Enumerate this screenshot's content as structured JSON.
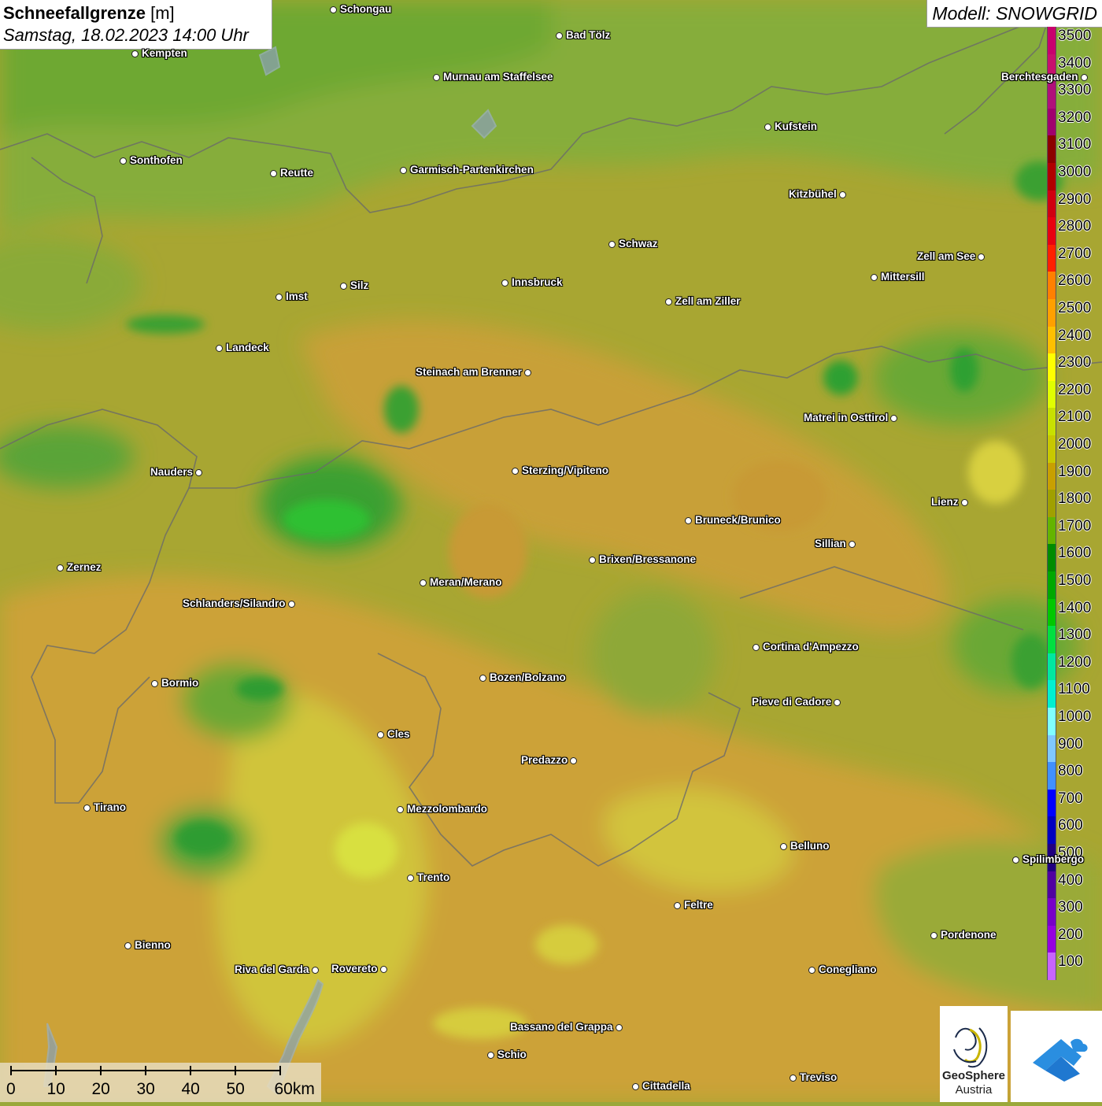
{
  "title": {
    "main": "Schneefallgrenze",
    "unit": "[m]",
    "datetime": "Samstag, 18.02.2023 14:00 Uhr"
  },
  "model": "Modell: SNOWGRID",
  "legend": {
    "levels": [
      "3500",
      "3400",
      "3300",
      "3200",
      "3100",
      "3000",
      "2900",
      "2800",
      "2700",
      "2600",
      "2500",
      "2400",
      "2300",
      "2200",
      "2100",
      "2000",
      "1900",
      "1800",
      "1700",
      "1600",
      "1500",
      "1400",
      "1300",
      "1200",
      "1100",
      "1000",
      "900",
      "800",
      "700",
      "600",
      "500",
      "400",
      "300",
      "200",
      "100"
    ],
    "colors": [
      "#c8006e",
      "#c8106e",
      "#b0107a",
      "#a0006e",
      "#8c0000",
      "#b00000",
      "#d00010",
      "#e80010",
      "#ff2000",
      "#ff8000",
      "#ffa000",
      "#ffc000",
      "#ffff00",
      "#e0ff00",
      "#c8e000",
      "#c8c800",
      "#c8a000",
      "#a0a000",
      "#64b400",
      "#008c00",
      "#00a800",
      "#00c800",
      "#00e040",
      "#00e8a0",
      "#00f0d0",
      "#80ffff",
      "#80c8ff",
      "#4090ff",
      "#0000ff",
      "#0000c0",
      "#200080",
      "#5000a0",
      "#7800c8",
      "#9600e0",
      "#c864ff"
    ]
  },
  "cities": [
    {
      "name": "Schongau",
      "label_side": "right"
    },
    {
      "name": "Bad Tölz",
      "label_side": "right"
    },
    {
      "name": "Kempten",
      "label_side": "right"
    },
    {
      "name": "Murnau am Staffelsee",
      "label_side": "right"
    },
    {
      "name": "Berchtesgaden",
      "label_side": "left"
    },
    {
      "name": "Kufstein",
      "label_side": "right"
    },
    {
      "name": "Sonthofen",
      "label_side": "right"
    },
    {
      "name": "Reutte",
      "label_side": "right"
    },
    {
      "name": "Garmisch-Partenkirchen",
      "label_side": "right"
    },
    {
      "name": "Kitzbühel",
      "label_side": "left"
    },
    {
      "name": "Schwaz",
      "label_side": "right"
    },
    {
      "name": "Zell am See",
      "label_side": "left"
    },
    {
      "name": "Innsbruck",
      "label_side": "right"
    },
    {
      "name": "Mittersill",
      "label_side": "right"
    },
    {
      "name": "Imst",
      "label_side": "right"
    },
    {
      "name": "Silz",
      "label_side": "right"
    },
    {
      "name": "Zell am Ziller",
      "label_side": "right"
    },
    {
      "name": "Landeck",
      "label_side": "right"
    },
    {
      "name": "Steinach am Brenner",
      "label_side": "left"
    },
    {
      "name": "Matrei in Osttirol",
      "label_side": "left"
    },
    {
      "name": "Nauders",
      "label_side": "left"
    },
    {
      "name": "Sterzing/Vipiteno",
      "label_side": "right"
    },
    {
      "name": "Lienz",
      "label_side": "left"
    },
    {
      "name": "Bruneck/Brunico",
      "label_side": "right"
    },
    {
      "name": "Sillian",
      "label_side": "left"
    },
    {
      "name": "Zernez",
      "label_side": "right"
    },
    {
      "name": "Brixen/Bressanone",
      "label_side": "right"
    },
    {
      "name": "Meran/Merano",
      "label_side": "right"
    },
    {
      "name": "Schlanders/Silandro",
      "label_side": "left"
    },
    {
      "name": "Cortina d'Ampezzo",
      "label_side": "right"
    },
    {
      "name": "Bozen/Bolzano",
      "label_side": "right"
    },
    {
      "name": "Bormio",
      "label_side": "right"
    },
    {
      "name": "Pieve di Cadore",
      "label_side": "left"
    },
    {
      "name": "Cles",
      "label_side": "right"
    },
    {
      "name": "Predazzo",
      "label_side": "left"
    },
    {
      "name": "Tirano",
      "label_side": "right"
    },
    {
      "name": "Mezzolombardo",
      "label_side": "right"
    },
    {
      "name": "Belluno",
      "label_side": "right"
    },
    {
      "name": "Spilimbergo",
      "label_side": "right"
    },
    {
      "name": "Trento",
      "label_side": "right"
    },
    {
      "name": "Feltre",
      "label_side": "right"
    },
    {
      "name": "Pordenone",
      "label_side": "right"
    },
    {
      "name": "Bienno",
      "label_side": "right"
    },
    {
      "name": "Riva del Garda",
      "label_side": "left"
    },
    {
      "name": "Rovereto",
      "label_side": "left"
    },
    {
      "name": "Conegliano",
      "label_side": "right"
    },
    {
      "name": "Bassano del Grappa",
      "label_side": "left"
    },
    {
      "name": "Schio",
      "label_side": "right"
    },
    {
      "name": "Treviso",
      "label_side": "right"
    },
    {
      "name": "Cittadella",
      "label_side": "right"
    }
  ],
  "scale_bar": {
    "ticks": [
      "0",
      "10",
      "20",
      "30",
      "40",
      "50",
      "60km"
    ]
  },
  "logos": {
    "geosphere_line1": "GeoSphere",
    "geosphere_line2": "Austria"
  }
}
